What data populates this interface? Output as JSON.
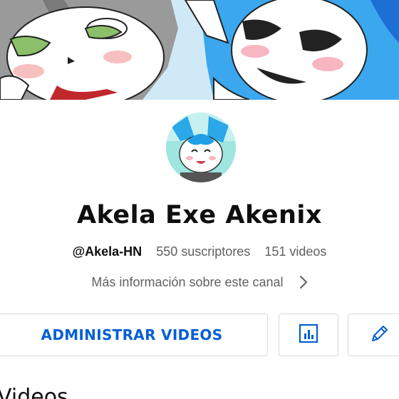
{
  "channel": {
    "name": "Akela Exe Akenix",
    "handle": "@Akela-HN",
    "subscribers": "550 suscriptores",
    "videos": "151 videos"
  },
  "more_info": {
    "label": "Más información sobre este canal",
    "icon": "chevron-right-icon"
  },
  "actions": {
    "manage_videos_label": "ADMINISTRAR VIDEOS",
    "stats_icon": "analytics-icon",
    "edit_icon": "pencil-icon"
  },
  "section": {
    "title": "Videos"
  },
  "colors": {
    "accent_blue": "#065fd4",
    "secondary_text": "#606060",
    "border": "#d9d9d9",
    "banner_sky": "#cfe9f7"
  }
}
